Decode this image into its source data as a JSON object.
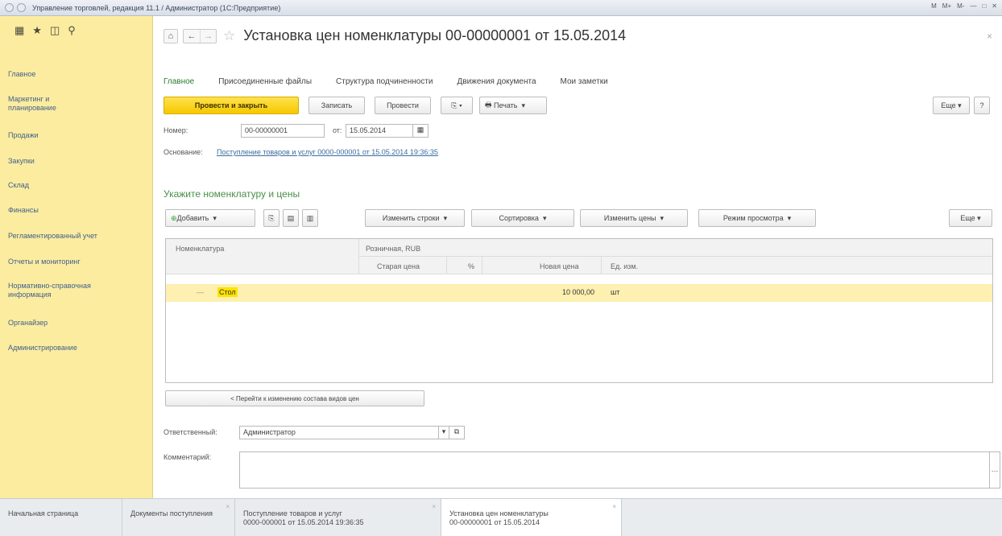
{
  "window": {
    "title": "Управление торговлей, редакция 11.1 / Администратор (1С:Предприятие)",
    "right_indicators": [
      "M",
      "M+",
      "M-"
    ]
  },
  "sidebar": {
    "tools": [
      "grid-icon",
      "star-icon",
      "history-icon",
      "search-icon"
    ],
    "items": [
      {
        "label": "Главное"
      },
      {
        "label": "Маркетинг и планирование"
      },
      {
        "label": "Продажи"
      },
      {
        "label": "Закупки"
      },
      {
        "label": "Склад"
      },
      {
        "label": "Финансы"
      },
      {
        "label": "Регламентированный учет"
      },
      {
        "label": "Отчеты и мониторинг"
      },
      {
        "label": "Нормативно-справочная информация"
      },
      {
        "label": "Органайзер"
      },
      {
        "label": "Администрирование"
      }
    ]
  },
  "document": {
    "title": "Установка цен номенклатуры 00-00000001 от 15.05.2014",
    "tabs": [
      "Главное",
      "Присоединенные файлы",
      "Структура подчиненности",
      "Движения документа",
      "Мои заметки"
    ],
    "buttons": {
      "post_close": "Провести и закрыть",
      "save": "Записать",
      "post": "Провести",
      "print": "Печать",
      "more": "Еще",
      "help": "?"
    },
    "number_label": "Номер:",
    "number_value": "00-00000001",
    "date_label": "от:",
    "date_value": "15.05.2014",
    "basis_label": "Основание:",
    "basis_link": "Поступление товаров и услуг 0000-000001 от 15.05.2014 19:36:35"
  },
  "section": {
    "title": "Укажите номенклатуру и цены",
    "toolbar": {
      "add": "Добавить",
      "change_rows": "Изменить строки",
      "sort": "Сортировка",
      "change_prices": "Изменить цены",
      "view_mode": "Режим просмотра",
      "more": "Еще"
    }
  },
  "table": {
    "col_item": "Номенклатура",
    "group_header": "Розничная, RUB",
    "col_old_price": "Старая цена",
    "col_percent": "%",
    "col_new_price": "Новая цена",
    "col_unit": "Ед. изм.",
    "rows": [
      {
        "item": "Стол",
        "old_price": "",
        "percent": "",
        "new_price": "10 000,00",
        "unit": "шт"
      }
    ]
  },
  "goto_button": "< Перейти к изменению состава видов цен",
  "responsible_label": "Ответственный:",
  "responsible_value": "Администратор",
  "comment_label": "Комментарий:",
  "comment_value": "",
  "taskbar": [
    {
      "line1": "Начальная страница",
      "line2": ""
    },
    {
      "line1": "Документы поступления",
      "line2": ""
    },
    {
      "line1": "Поступление товаров и услуг",
      "line2": "0000-000001 от 15.05.2014 19:36:35"
    },
    {
      "line1": "Установка цен номенклатуры",
      "line2": "00-00000001 от 15.05.2014"
    }
  ]
}
